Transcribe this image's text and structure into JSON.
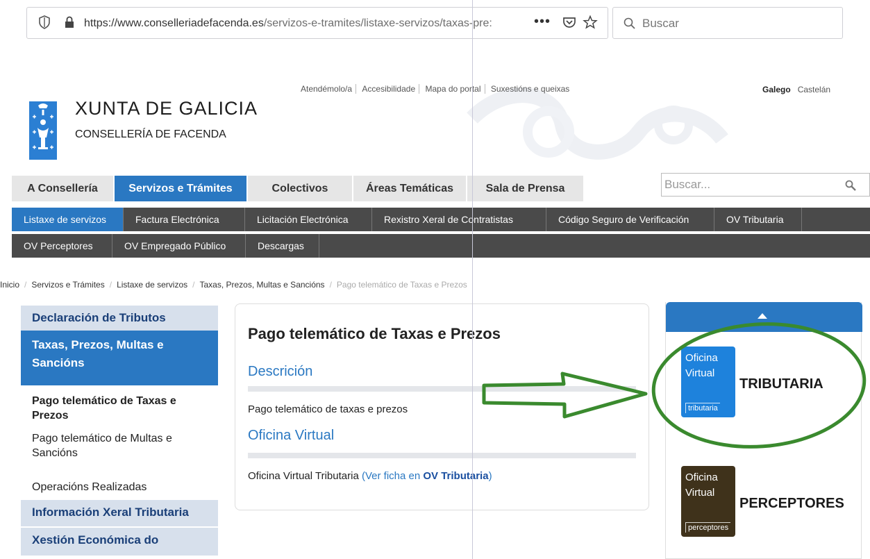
{
  "browser": {
    "url_host": "https://www.conselleriadefacenda.es",
    "url_path": "/servizos-e-tramites/listaxe-servizos/taxas-pre:",
    "more_label": "•••",
    "search_placeholder": "Buscar"
  },
  "header": {
    "logo_title": "XUNTA DE GALICIA",
    "logo_subtitle": "CONSELLERÍA DE FACENDA",
    "utility_links": [
      "Atendémolo/a",
      "Accesibilidade",
      "Mapa do portal",
      "Suxestións e queixas"
    ],
    "lang_active": "Galego",
    "lang_other": "Castelán"
  },
  "main_nav": {
    "items": [
      {
        "label": "A Consellería",
        "active": false
      },
      {
        "label": "Servizos e Trámites",
        "active": true
      },
      {
        "label": "Colectivos",
        "active": false
      },
      {
        "label": "Áreas Temáticas",
        "active": false
      },
      {
        "label": "Sala de Prensa",
        "active": false
      }
    ],
    "search_placeholder": "Buscar..."
  },
  "sub_nav": {
    "row1": [
      {
        "label": "Listaxe de servizos",
        "active": true
      },
      {
        "label": "Factura Electrónica",
        "active": false
      },
      {
        "label": "Licitación Electrónica",
        "active": false
      },
      {
        "label": "Rexistro Xeral de Contratistas",
        "active": false
      },
      {
        "label": "Código Seguro de Verificación",
        "active": false
      },
      {
        "label": "OV Tributaria",
        "active": false
      }
    ],
    "row2": [
      {
        "label": "OV Perceptores",
        "active": false
      },
      {
        "label": "OV Empregado Público",
        "active": false
      },
      {
        "label": "Descargas",
        "active": false
      }
    ]
  },
  "breadcrumb": [
    "Inicio",
    "Servizos e Trámites",
    "Listaxe de servizos",
    "Taxas, Prezos, Multas e Sancións",
    "Pago telemático de Taxas e Prezos"
  ],
  "sidebar": {
    "h1": "Declaración de Tributos",
    "h2": "Taxas, Prezos, Multas e Sancións",
    "l1": "Pago telemático de Taxas e Prezos",
    "l2": "Pago telemático de Multas e Sancións",
    "l3": "Operacións Realizadas",
    "h3": "Información Xeral Tributaria",
    "h4": "Xestión Económica do"
  },
  "content": {
    "title": "Pago telemático de Taxas e Prezos",
    "section1_heading": "Descrición",
    "section1_text": "Pago telemático de taxas e prezos",
    "section2_heading": "Oficina Virtual",
    "section2_text": "Oficina Virtual Tributaria",
    "section2_link_open": "(Ver ficha en",
    "section2_link_bold": "OV Tributaria",
    "section2_link_close": ")"
  },
  "right_panel": {
    "logo_word1": "Oficina",
    "logo_word2": "Virtual",
    "tributaria_tag": "tributaria",
    "tributaria_label": "TRIBUTARIA",
    "perceptores_tag": "perceptores",
    "perceptores_label": "PERCEPTORES"
  },
  "colors": {
    "brand_blue": "#2a78c2",
    "subnav_dark": "#4a4a4a",
    "annotation_green": "#3a8a2e",
    "perceptores_brown": "#4a3a1e"
  }
}
